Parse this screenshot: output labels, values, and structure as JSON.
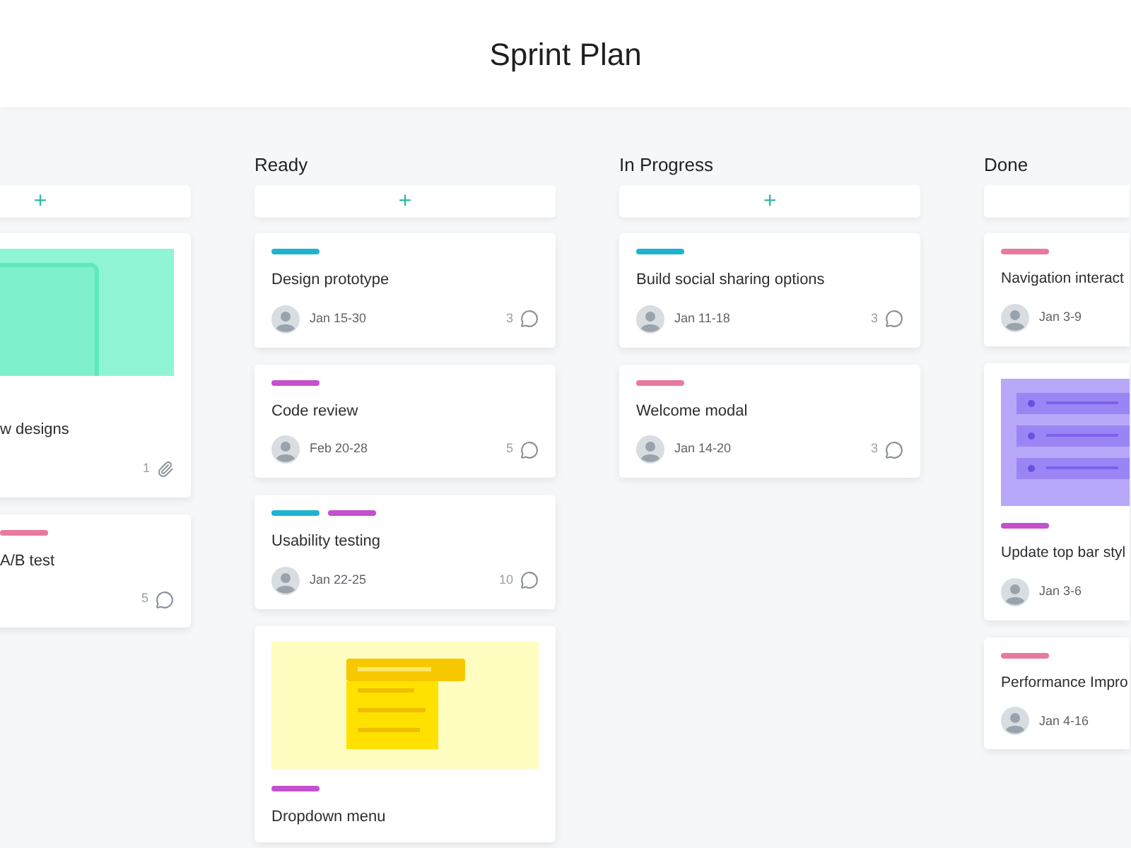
{
  "title": "Sprint Plan",
  "columns": [
    {
      "add_label": "+",
      "cards": [
        {
          "cover": {
            "kind": "phone"
          },
          "title": "w designs",
          "meta": {
            "kind": "attachments",
            "count": "1"
          }
        },
        {
          "tags": [
            {
              "color": "#e8799f"
            }
          ],
          "title": "A/B test",
          "meta": {
            "kind": "comments",
            "count": "5"
          }
        }
      ]
    },
    {
      "title": "Ready",
      "add_label": "+",
      "cards": [
        {
          "tags": [
            {
              "color": "#1fb3d0"
            }
          ],
          "title": "Design prototype",
          "date": "Jan 15-30",
          "meta": {
            "kind": "comments",
            "count": "3"
          }
        },
        {
          "tags": [
            {
              "color": "#c550cc"
            }
          ],
          "title": "Code review",
          "date": "Feb 20-28",
          "meta": {
            "kind": "comments",
            "count": "5"
          }
        },
        {
          "tags": [
            {
              "color": "#1fb3d0"
            },
            {
              "color": "#c550cc"
            }
          ],
          "title": "Usability testing",
          "date": "Jan 22-25",
          "meta": {
            "kind": "comments",
            "count": "10"
          }
        },
        {
          "cover": {
            "kind": "dropdown"
          },
          "tags": [
            {
              "color": "#c550cc"
            }
          ],
          "title": "Dropdown menu"
        }
      ]
    },
    {
      "title": "In Progress",
      "add_label": "+",
      "cards": [
        {
          "tags": [
            {
              "color": "#1fb3d0"
            }
          ],
          "title": "Build social sharing options",
          "date": "Jan 11-18",
          "meta": {
            "kind": "comments",
            "count": "3"
          }
        },
        {
          "tags": [
            {
              "color": "#e8799f"
            }
          ],
          "title": "Welcome modal",
          "date": "Jan 14-20",
          "meta": {
            "kind": "comments",
            "count": "3"
          }
        }
      ]
    },
    {
      "title": "Done",
      "cards": [
        {
          "tags": [
            {
              "color": "#e8799f"
            }
          ],
          "title": "Navigation interact",
          "date": "Jan 3-9"
        },
        {
          "cover": {
            "kind": "list"
          },
          "tags": [
            {
              "color": "#c550cc"
            }
          ],
          "title": "Update top bar styl",
          "date": "Jan 3-6"
        },
        {
          "tags": [
            {
              "color": "#e8799f"
            }
          ],
          "title": "Performance Impro",
          "date": "Jan 4-16"
        }
      ]
    }
  ]
}
